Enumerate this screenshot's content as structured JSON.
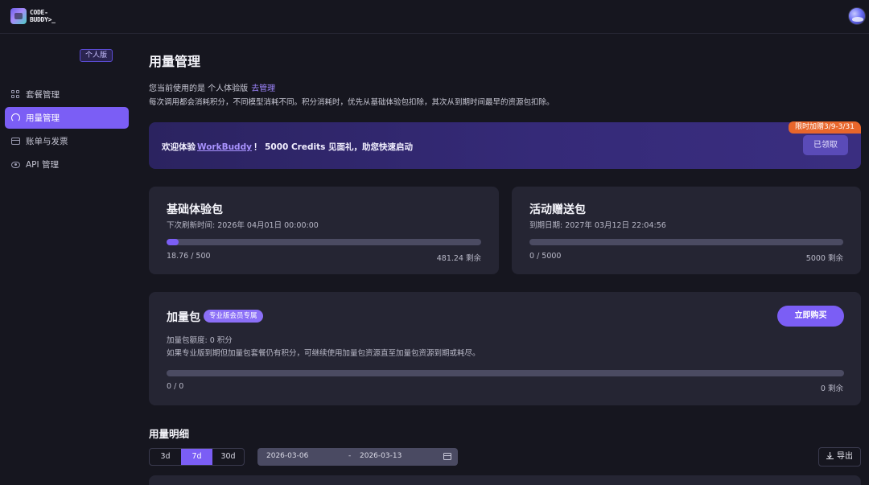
{
  "brand": {
    "logo_line1": "CODE-",
    "logo_line2": "BUDDY>_"
  },
  "sidebar": {
    "plan_badge": "个人版",
    "items": [
      {
        "label": "套餐管理",
        "icon": "grid-icon",
        "active": false
      },
      {
        "label": "用量管理",
        "icon": "gauge-icon",
        "active": true
      },
      {
        "label": "账单与发票",
        "icon": "card-icon",
        "active": false
      },
      {
        "label": "API 管理",
        "icon": "eye-icon",
        "active": false
      }
    ]
  },
  "main": {
    "title": "用量管理",
    "plan_prefix": "您当前使用的是 个人体验版",
    "plan_link": "去管理",
    "rule_text": "每次调用都会消耗积分，不同模型消耗不同。积分消耗时，优先从基础体验包扣除，其次从到期时间最早的资源包扣除。"
  },
  "banner": {
    "prefix": "欢迎体验",
    "link": "WorkBuddy",
    "suffix": "！ 5000 Credits 见面礼，助您快速启动",
    "promo_tag": "限时加赠3/9-3/31",
    "claimed_label": "已领取"
  },
  "cards": {
    "basic": {
      "title": "基础体验包",
      "sub": "下次刷新时间: 2026年 04月01日 00:00:00",
      "used_text": "18.76 / 500",
      "remaining_text": "481.24 剩余",
      "progress": 0.0375
    },
    "gift": {
      "title": "活动赠送包",
      "sub": "到期日期:   2027年 03月12日 22:04:56",
      "used_text": "0 / 5000",
      "remaining_text": "5000 剩余",
      "progress": 0
    },
    "addon": {
      "title": "加量包",
      "badge": "专业版会员专属",
      "buy_label": "立即购买",
      "quota": "加量包额度: 0 积分",
      "note": "如果专业版到期但加量包套餐仍有积分，可继续使用加量包资源直至加量包资源到期或耗尽。",
      "used_text": "0 / 0",
      "remaining_text": "0 剩余",
      "progress": 0
    }
  },
  "usage": {
    "title": "用量明细",
    "ranges": [
      {
        "label": "3d",
        "active": false
      },
      {
        "label": "7d",
        "active": true
      },
      {
        "label": "30d",
        "active": false
      }
    ],
    "date_start": "2026-03-06",
    "date_sep": "-",
    "date_end": "2026-03-13",
    "export_label": "导出"
  },
  "colors": {
    "accent": "#7b5ef5",
    "promo": "#e8662b",
    "background": "#16161f",
    "card": "#252533"
  }
}
